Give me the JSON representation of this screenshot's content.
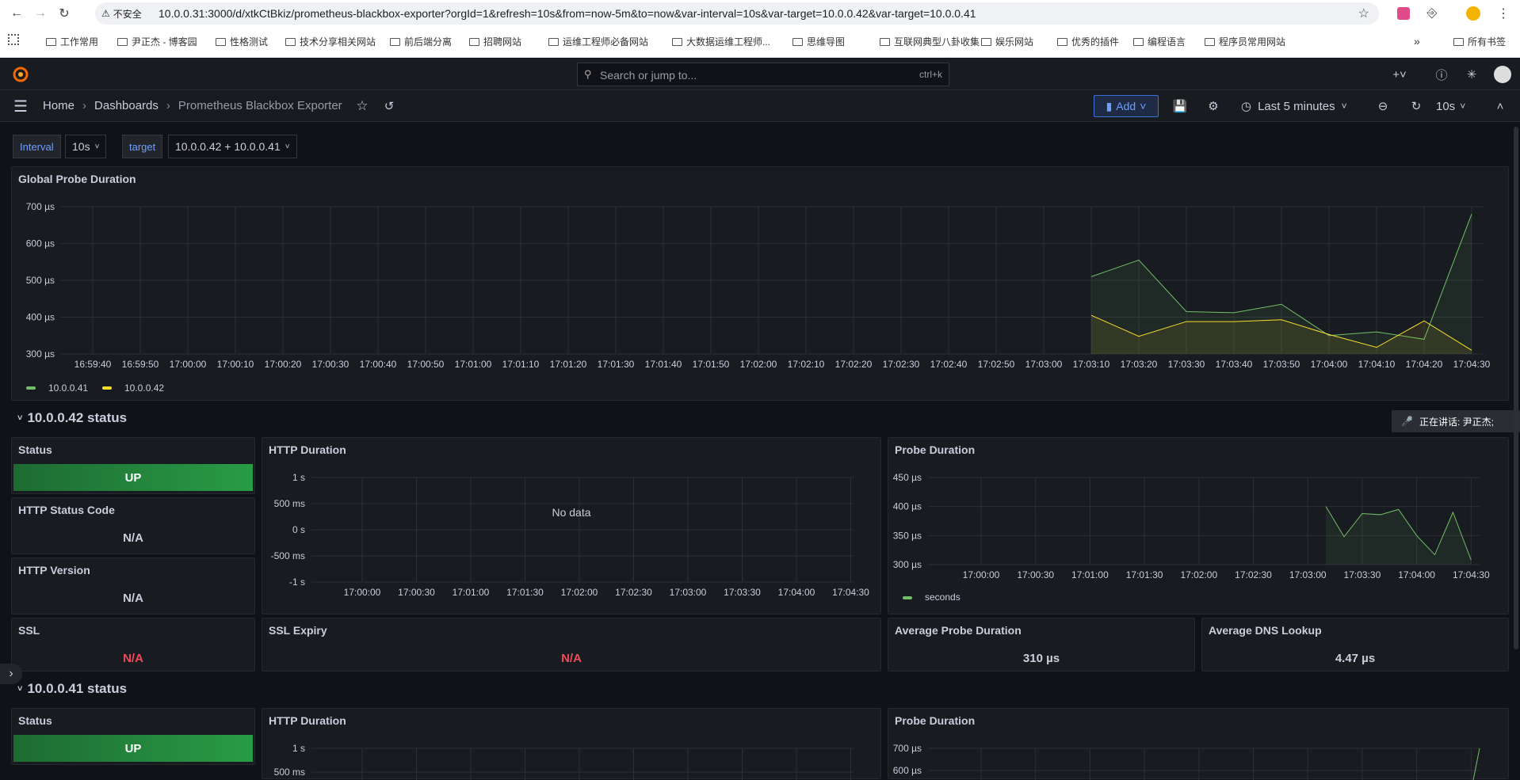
{
  "browser": {
    "insecure_label": "不安全",
    "url": "10.0.0.31:3000/d/xtkCtBkiz/prometheus-blackbox-exporter?orgId=1&refresh=10s&from=now-5m&to=now&var-interval=10s&var-target=10.0.0.42&var-target=10.0.0.41",
    "bookmarks": [
      "工作常用",
      "尹正杰 - 博客园",
      "性格测试",
      "技术分享相关网站",
      "前后端分离",
      "招聘网站",
      "运维工程师必备网站",
      "大数据运维工程师...",
      "思维导图",
      "互联网典型八卦收集",
      "娱乐网站",
      "优秀的插件",
      "编程语言",
      "程序员常用网站"
    ],
    "all_bookmarks": "所有书签"
  },
  "grafana": {
    "search_placeholder": "Search or jump to...",
    "search_shortcut": "ctrl+k",
    "breadcrumb": {
      "home": "Home",
      "dashboards": "Dashboards",
      "current": "Prometheus Blackbox Exporter"
    },
    "add_label": "Add",
    "time_range": "Last 5 minutes",
    "refresh": "10s"
  },
  "variables": {
    "interval_label": "Interval",
    "interval_value": "10s",
    "target_label": "target",
    "target_value": "10.0.0.42 + 10.0.0.41"
  },
  "speaking": "正在讲话: 尹正杰;",
  "global_panel": {
    "title": "Global Probe Duration",
    "y_ticks": [
      "700 µs",
      "600 µs",
      "500 µs",
      "400 µs",
      "300 µs"
    ],
    "x_ticks": [
      "16:59:40",
      "16:59:50",
      "17:00:00",
      "17:00:10",
      "17:00:20",
      "17:00:30",
      "17:00:40",
      "17:00:50",
      "17:01:00",
      "17:01:10",
      "17:01:20",
      "17:01:30",
      "17:01:40",
      "17:01:50",
      "17:02:00",
      "17:02:10",
      "17:02:20",
      "17:02:30",
      "17:02:40",
      "17:02:50",
      "17:03:00",
      "17:03:10",
      "17:03:20",
      "17:03:30",
      "17:03:40",
      "17:03:50",
      "17:04:00",
      "17:04:10",
      "17:04:20",
      "17:04:30"
    ],
    "legend": [
      "10.0.0.41",
      "10.0.0.42"
    ]
  },
  "row42": {
    "title": "10.0.0.42 status",
    "status_title": "Status",
    "status_value": "UP",
    "http_status_title": "HTTP Status Code",
    "http_status_value": "N/A",
    "http_version_title": "HTTP Version",
    "http_version_value": "N/A",
    "ssl_title": "SSL",
    "ssl_value": "N/A",
    "ssl_expiry_title": "SSL Expiry",
    "ssl_expiry_value": "N/A",
    "http_duration_title": "HTTP Duration",
    "http_y_ticks": [
      "1 s",
      "500 ms",
      "0 s",
      "-500 ms",
      "-1 s"
    ],
    "http_x_ticks": [
      "17:00:00",
      "17:00:30",
      "17:01:00",
      "17:01:30",
      "17:02:00",
      "17:02:30",
      "17:03:00",
      "17:03:30",
      "17:04:00",
      "17:04:30"
    ],
    "no_data": "No data",
    "probe_duration_title": "Probe Duration",
    "probe_y_ticks": [
      "450 µs",
      "400 µs",
      "350 µs",
      "300 µs"
    ],
    "probe_x_ticks": [
      "17:00:00",
      "17:00:30",
      "17:01:00",
      "17:01:30",
      "17:02:00",
      "17:02:30",
      "17:03:00",
      "17:03:30",
      "17:04:00",
      "17:04:30"
    ],
    "probe_legend": "seconds",
    "avg_probe_title": "Average Probe Duration",
    "avg_probe_value": "310 µs",
    "avg_dns_title": "Average DNS Lookup",
    "avg_dns_value": "4.47 µs"
  },
  "row41": {
    "title": "10.0.0.41 status",
    "status_title": "Status",
    "status_value": "UP",
    "http_duration_title": "HTTP Duration",
    "http_y_ticks": [
      "1 s",
      "500 ms"
    ],
    "probe_duration_title": "Probe Duration",
    "probe_y_ticks": [
      "700 µs",
      "600 µs"
    ]
  },
  "colors": {
    "green_series": "#73bf69",
    "yellow_series": "#fade2a",
    "status_up": "#299c46",
    "na_red": "#f2495c"
  },
  "chart_data": [
    {
      "type": "area",
      "title": "Global Probe Duration",
      "x": [
        "17:03:10",
        "17:03:20",
        "17:03:30",
        "17:03:40",
        "17:03:50",
        "17:04:00",
        "17:04:10",
        "17:04:20",
        "17:04:30"
      ],
      "ylim": [
        300,
        700
      ],
      "series": [
        {
          "name": "10.0.0.41",
          "values": [
            510,
            555,
            415,
            412,
            435,
            350,
            360,
            340,
            680
          ]
        },
        {
          "name": "10.0.0.42",
          "values": [
            405,
            348,
            388,
            388,
            393,
            353,
            318,
            390,
            310
          ]
        }
      ]
    },
    {
      "type": "area",
      "title": "Probe Duration",
      "x": [
        "17:03:10",
        "17:03:20",
        "17:03:30",
        "17:03:40",
        "17:03:50",
        "17:04:00",
        "17:04:10",
        "17:04:20",
        "17:04:30"
      ],
      "ylim": [
        300,
        450
      ],
      "series": [
        {
          "name": "seconds",
          "values": [
            400,
            348,
            388,
            386,
            395,
            350,
            317,
            390,
            308
          ]
        }
      ]
    }
  ]
}
